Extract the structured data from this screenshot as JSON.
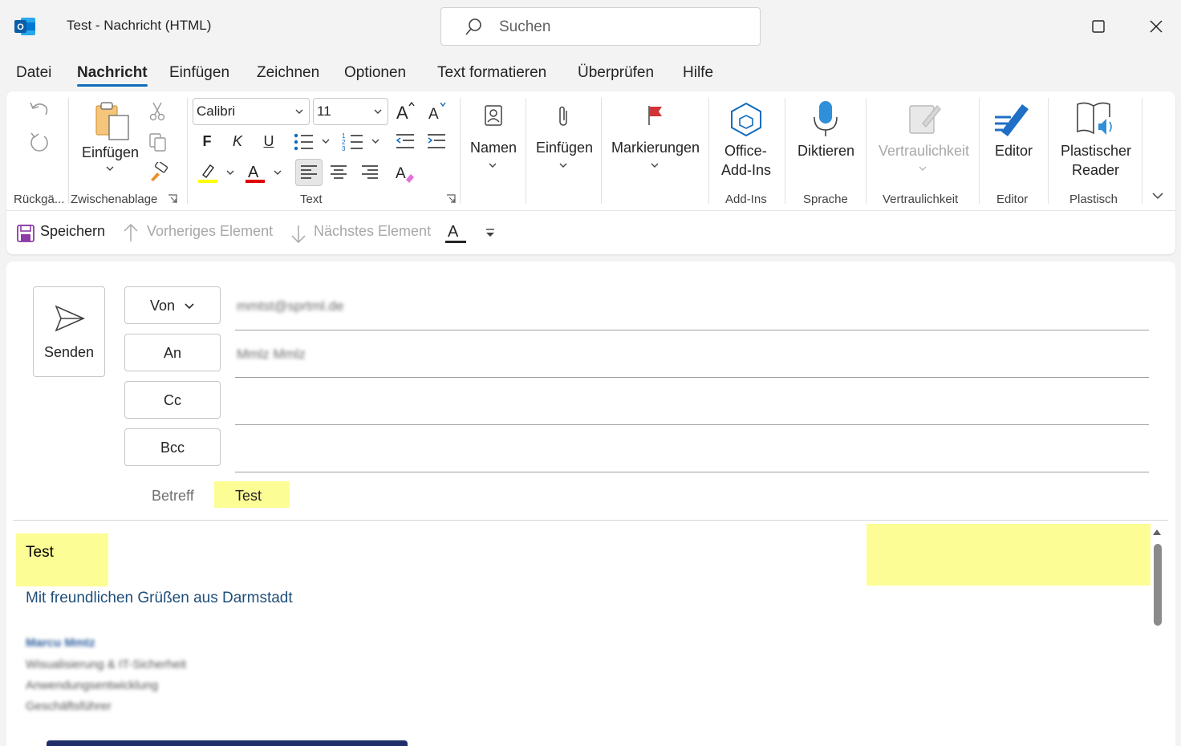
{
  "window": {
    "title": "Test  -  Nachricht (HTML)",
    "search_placeholder": "Suchen"
  },
  "menu": {
    "tabs": [
      "Datei",
      "Nachricht",
      "Einfügen",
      "Zeichnen",
      "Optionen",
      "Text formatieren",
      "Überprüfen",
      "Hilfe"
    ],
    "active": "Nachricht"
  },
  "ribbon": {
    "groups": {
      "undo": "Rückgä...",
      "clipboard": "Zwischenablage",
      "text": "Text",
      "addins": "Add-Ins",
      "speech": "Sprache",
      "sensitivity": "Vertraulichkeit",
      "editor": "Editor",
      "reader": "Plastisch"
    },
    "paste_label": "Einfügen",
    "font_name": "Calibri",
    "font_size": "11",
    "bold": "F",
    "italic": "K",
    "underline": "U",
    "names_label": "Namen",
    "attach_label": "Einfügen",
    "flag_label": "Markierungen",
    "office_addins_line1": "Office-",
    "office_addins_line2": "Add-Ins",
    "dictate_label": "Diktieren",
    "sensitivity_label": "Vertraulichkeit",
    "editor_label": "Editor",
    "reader_line1": "Plastischer",
    "reader_line2": "Reader"
  },
  "qat": {
    "save": "Speichern",
    "previous": "Vorheriges Element",
    "next": "Nächstes Element"
  },
  "compose": {
    "send": "Senden",
    "from_button": "Von",
    "to_button": "An",
    "cc_button": "Cc",
    "bcc_button": "Bcc",
    "from_value": "mmtst@sprtml.de",
    "to_value": "Mmlz Mmlz",
    "subject_label": "Betreff",
    "subject_value": "Test",
    "body_text": "Test",
    "greeting": "Mit freundlichen Grüßen aus Darmstadt",
    "signature": [
      "Marcu Mmtz",
      "Wisualisierung & IT-Sicherheit",
      "Anwendungsentwicklung",
      "Geschäftsführer"
    ]
  },
  "colors": {
    "accent": "#0f6cbd",
    "highlight": "#fdfd96",
    "greeting": "#1f4e79",
    "flag": "#d13438"
  }
}
